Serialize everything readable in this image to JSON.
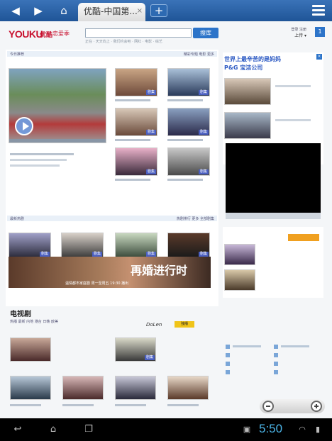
{
  "browser": {
    "tab_title": "优酷-中国第...",
    "tab_close": "×",
    "new_tab": "+"
  },
  "site": {
    "logo": "YOUKU",
    "logo_cn": "优酷",
    "logo_slogan": "恋爱季",
    "search_button": "搜库",
    "search_tags": "正在 · 天天向上 · 我们约会吧 · 网红 · 电影 · 综艺",
    "header_links": "登录  注册",
    "header_dropdown": "上传 ▾",
    "header_badge": "1"
  },
  "sections": {
    "top_label": "今日推荐",
    "top_more": "精彩专题  电影  更多",
    "mid_label": "最新热剧",
    "mid_more": "热剧排行  更多  全部剧集"
  },
  "thumb_tag": "剧集",
  "banner": {
    "title": "再婚进行时",
    "subtitle": "温情都市家庭剧  周一至周五 19:30 播出"
  },
  "ad": {
    "title": "世界上最辛苦的是妈妈",
    "subtitle": "P&G 宝洁公司",
    "close": "×"
  },
  "tv": {
    "title": "电视剧",
    "tabs": "热播  最新  内地  港台  日韩  欧美",
    "dolen": "DoLen",
    "dolen_tag": "独播"
  },
  "status": {
    "time": "5:50"
  }
}
